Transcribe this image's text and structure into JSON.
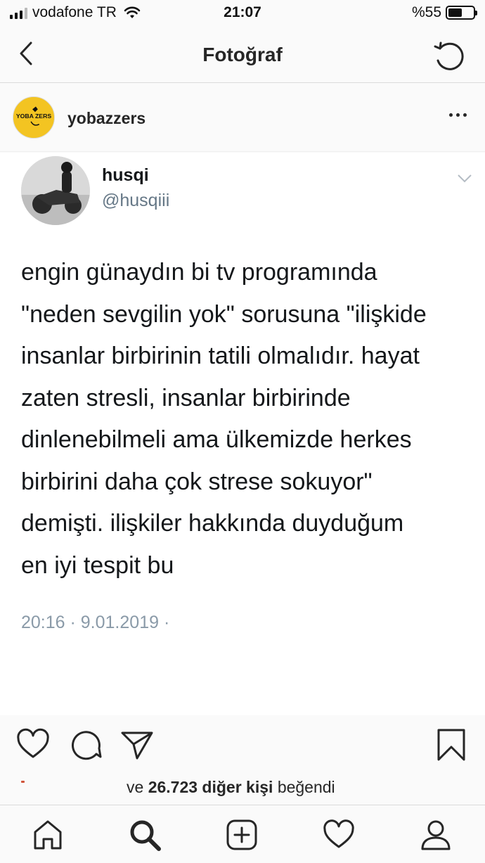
{
  "status_bar": {
    "carrier": "vodafone TR",
    "time": "21:07",
    "battery_label": "%55",
    "battery_level": 0.55
  },
  "nav": {
    "title": "Fotoğraf",
    "back_icon": "chevron-left-icon",
    "refresh_icon": "refresh-icon"
  },
  "post": {
    "username": "yobazzers",
    "avatar_text": "YOBAZZERS",
    "more_icon": "more-horizontal-icon"
  },
  "tweet": {
    "name": "husqi",
    "handle": "@husqiii",
    "lines": [
      "engin günaydın bi tv programında",
      "\"neden sevgilin yok\" sorusuna \"ilişkide",
      "insanlar birbirinin tatili olmalıdır. hayat",
      "zaten stresli, insanlar birbirinde",
      "dinlenebilmeli ama ülkemizde herkes",
      "birbirini daha çok strese sokuyor\"",
      "demişti. ilişkiler hakkında duyduğum",
      "en iyi tespit bu"
    ],
    "meta": "20:16 · 9.01.2019 ·"
  },
  "likes": {
    "prefix": "ve",
    "count": "26.723 diğer kişi",
    "suffix": "beğendi"
  },
  "tabs": [
    {
      "name": "home",
      "icon": "home-icon"
    },
    {
      "name": "search",
      "icon": "search-icon"
    },
    {
      "name": "new-post",
      "icon": "plus-square-icon"
    },
    {
      "name": "activity",
      "icon": "heart-icon"
    },
    {
      "name": "profile",
      "icon": "profile-icon"
    }
  ]
}
